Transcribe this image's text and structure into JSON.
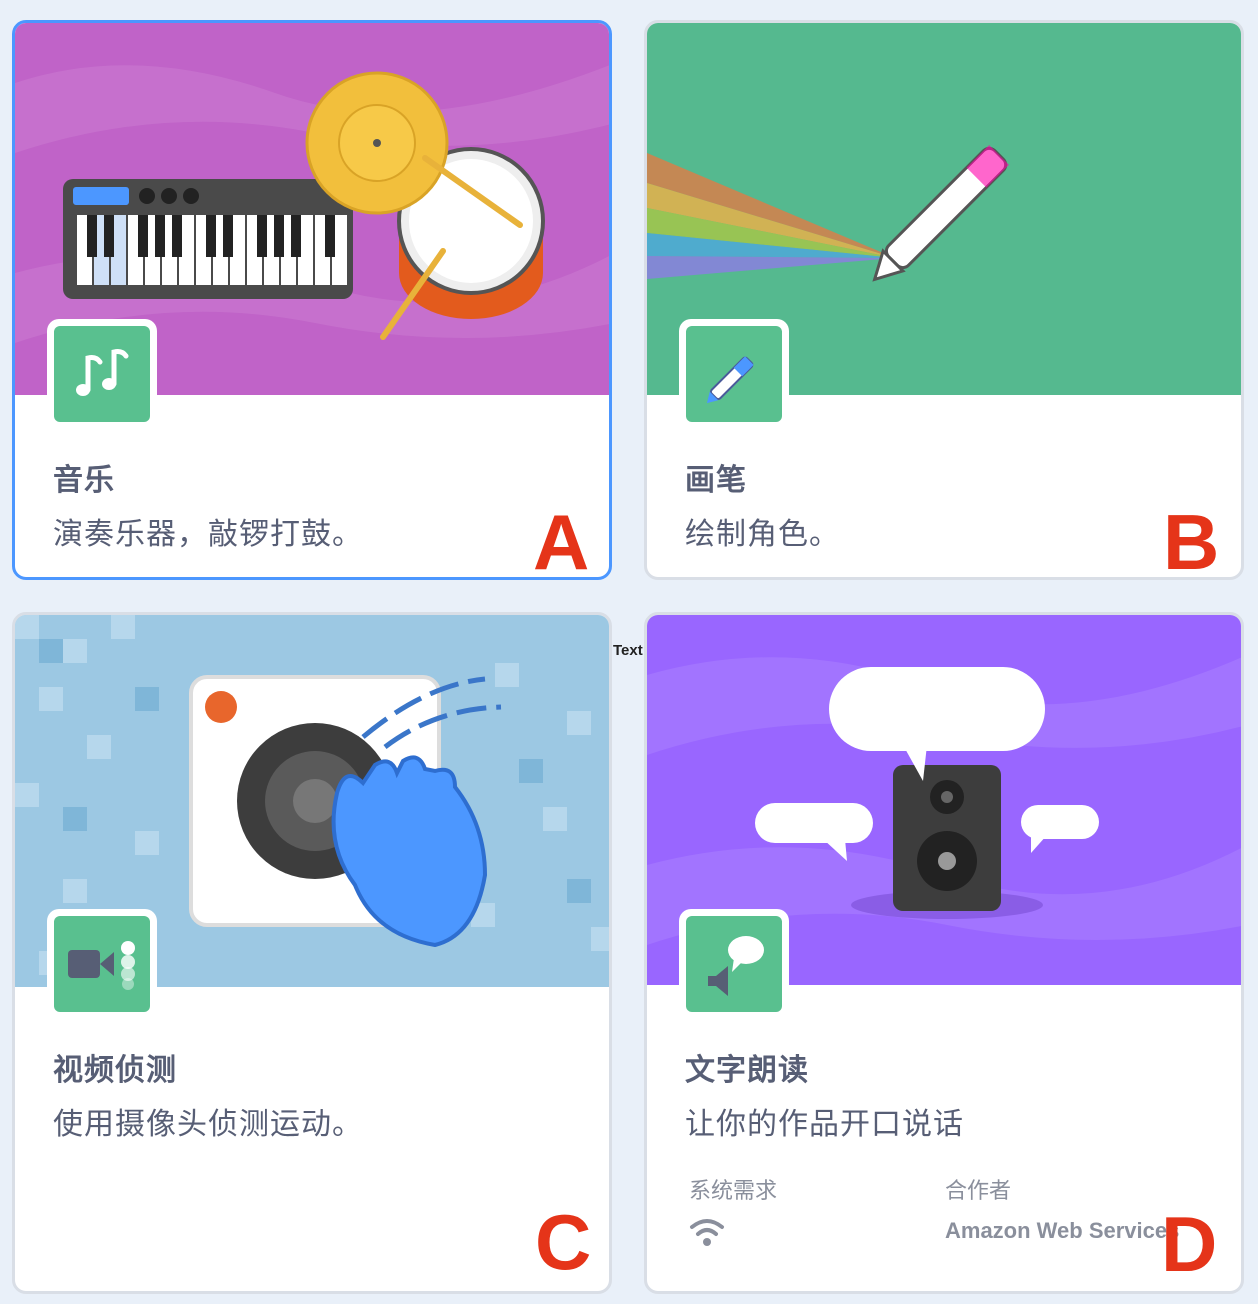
{
  "cards": [
    {
      "title": "音乐",
      "description": "演奏乐器，敲锣打鼓。",
      "marker": "A",
      "icon": "music-notes-icon"
    },
    {
      "title": "画笔",
      "description": "绘制角色。",
      "marker": "B",
      "icon": "pen-icon"
    },
    {
      "title": "视频侦测",
      "description": "使用摄像头侦测运动。",
      "marker": "C",
      "icon": "video-camera-icon"
    },
    {
      "title": "文字朗读",
      "description": "让你的作品开口说话",
      "marker": "D",
      "icon": "speech-bubble-speaker-icon",
      "requirements_label": "系统需求",
      "requirements_icon": "wifi-icon",
      "collaborator_label": "合作者",
      "collaborator_name": "Amazon Web Services"
    }
  ],
  "floating_label": "Text",
  "colors": {
    "selected_border": "#4c97ff",
    "badge_green": "#59c08f",
    "marker_red": "#e53419"
  }
}
